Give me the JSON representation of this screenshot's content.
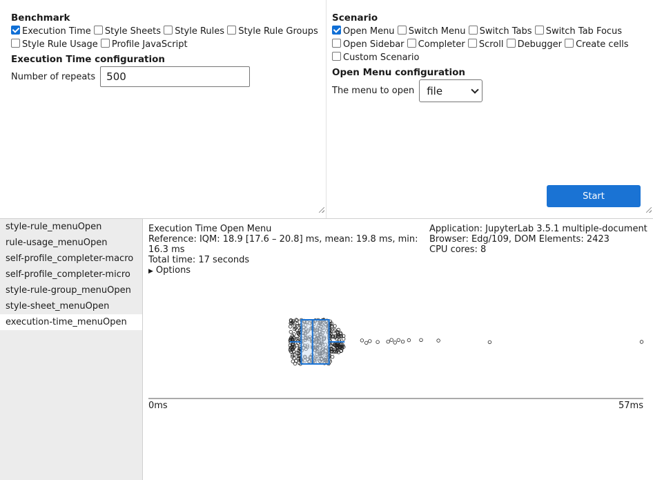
{
  "benchmark": {
    "title": "Benchmark",
    "options": [
      {
        "label": "Execution Time",
        "checked": true
      },
      {
        "label": "Style Sheets",
        "checked": false
      },
      {
        "label": "Style Rules",
        "checked": false
      },
      {
        "label": "Style Rule Groups",
        "checked": false
      },
      {
        "label": "Style Rule Usage",
        "checked": false
      },
      {
        "label": "Profile JavaScript",
        "checked": false
      }
    ],
    "config_title": "Execution Time configuration",
    "repeats_label": "Number of repeats",
    "repeats_value": "500"
  },
  "scenario": {
    "title": "Scenario",
    "options": [
      {
        "label": "Open Menu",
        "checked": true
      },
      {
        "label": "Switch Menu",
        "checked": false
      },
      {
        "label": "Switch Tabs",
        "checked": false
      },
      {
        "label": "Switch Tab Focus",
        "checked": false
      },
      {
        "label": "Open Sidebar",
        "checked": false
      },
      {
        "label": "Completer",
        "checked": false
      },
      {
        "label": "Scroll",
        "checked": false
      },
      {
        "label": "Debugger",
        "checked": false
      },
      {
        "label": "Create cells",
        "checked": false
      },
      {
        "label": "Custom Scenario",
        "checked": false
      }
    ],
    "config_title": "Open Menu configuration",
    "menu_label": "The menu to open",
    "menu_value": "file",
    "start_label": "Start"
  },
  "sidebar": {
    "items": [
      {
        "label": "style-rule_menuOpen",
        "active": false
      },
      {
        "label": "rule-usage_menuOpen",
        "active": false
      },
      {
        "label": "self-profile_completer-macro",
        "active": false
      },
      {
        "label": "self-profile_completer-micro",
        "active": false
      },
      {
        "label": "style-rule-group_menuOpen",
        "active": false
      },
      {
        "label": "style-sheet_menuOpen",
        "active": false
      },
      {
        "label": "execution-time_menuOpen",
        "active": true
      }
    ]
  },
  "result": {
    "title": "Execution Time Open Menu",
    "reference": "Reference: IQM: 18.9 [17.6 – 20.8] ms, mean: 19.8 ms, min: 16.3 ms",
    "total_time": "Total time: 17 seconds",
    "options_label": "Options",
    "application": "Application: JupyterLab 3.5.1 multiple-document",
    "browser": "Browser: Edg/109, DOM Elements: 2423",
    "cpu": "CPU cores: 8"
  },
  "chart_data": {
    "type": "scatter",
    "subtype": "boxplot-with-jittered-points",
    "xlim": [
      0,
      57
    ],
    "x_tick_labels": [
      "0ms",
      "57ms"
    ],
    "box": {
      "whisker_low": 16.3,
      "q1": 17.6,
      "median": 18.9,
      "q3": 20.8,
      "whisker_high": 22.6
    },
    "outliers": [
      24.6,
      25.1,
      25.5,
      26.4,
      27.6,
      28.0,
      28.4,
      28.8,
      29.3,
      30.0,
      31.4,
      33.4,
      39.3
    ],
    "stats": {
      "iqm": 18.9,
      "mean": 19.8,
      "min": 16.3,
      "max": 56.8,
      "repeats": 500
    },
    "colors": {
      "box": "#1a73d4",
      "box_fill": "#cfe0f3",
      "points": "#222222"
    }
  }
}
